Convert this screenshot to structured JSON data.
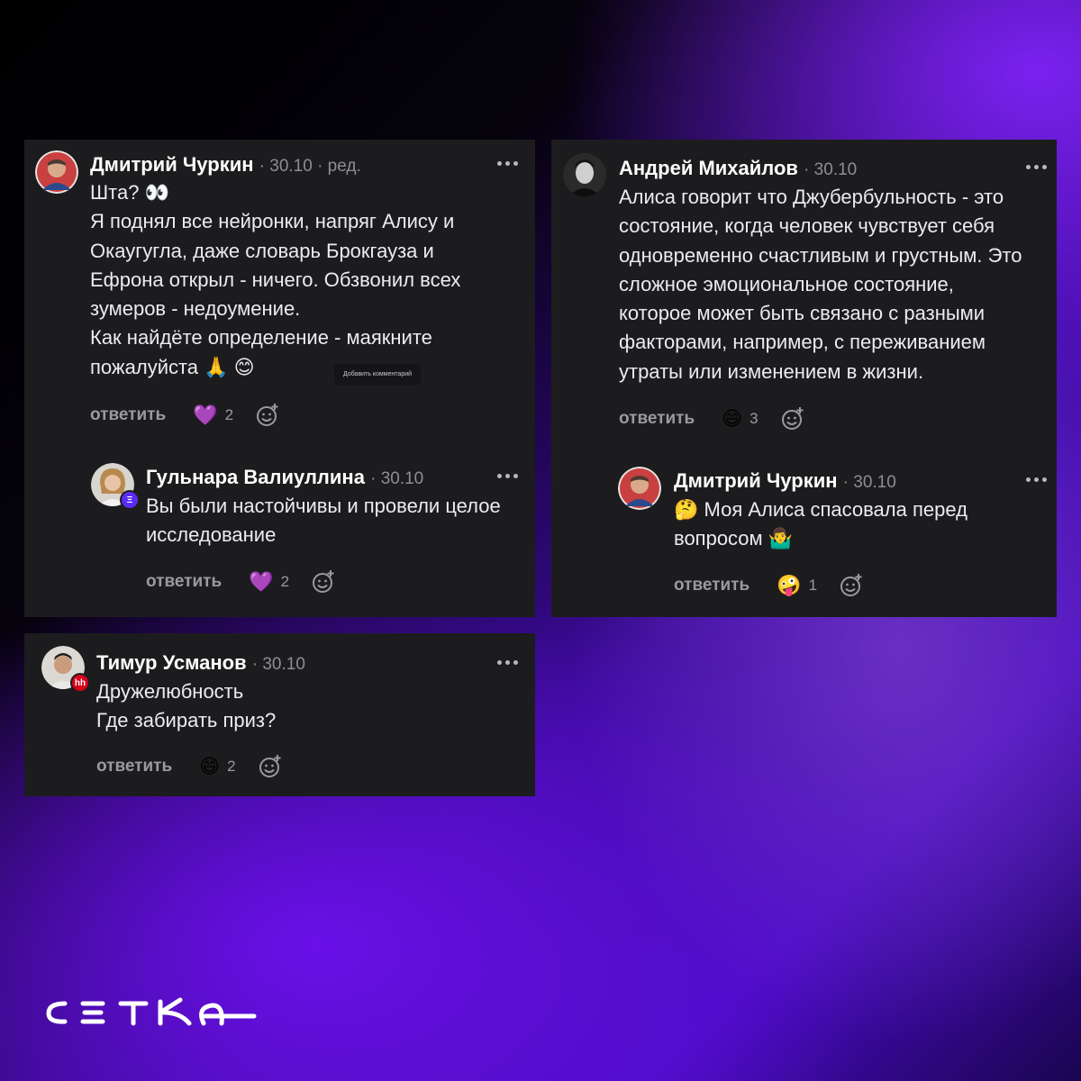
{
  "comments": [
    {
      "author": "Дмитрий Чуркин",
      "date": "· 30.10 · ред.",
      "lines": [
        "Шта? 👀",
        "Я поднял все нейронки, напряг Алису и",
        "Окаугугла, даже словарь Брокгауза и",
        "Ефрона открыл - ничего. Обзвонил всех",
        "зумеров - недоумение.",
        "Как найдёте определение - маякните",
        "пожалуйста 🙏 😊"
      ],
      "reply_label": "ответить",
      "reaction_emoji": "💜",
      "reaction_count": "2",
      "tooltip": "Добавить комментарий"
    },
    {
      "author": "Гульнара Валиуллина",
      "date": "· 30.10",
      "lines": [
        "Вы были настойчивы и провели целое",
        "исследование"
      ],
      "reply_label": "ответить",
      "reaction_emoji": "💜",
      "reaction_count": "2"
    },
    {
      "author": "Андрей Михайлов",
      "date": "· 30.10",
      "lines": [
        "Алиса говорит что Джубербульность - это",
        "состояние, когда человек чувствует себя",
        "одновременно счастливым и грустным. Это",
        "сложное эмоциональное состояние,",
        "которое может быть связано с разными",
        "факторами, например, с переживанием",
        "утраты или изменением в жизни."
      ],
      "reply_label": "ответить",
      "reaction_emoji": "😄",
      "reaction_count": "3"
    },
    {
      "author": "Дмитрий Чуркин",
      "date": "· 30.10",
      "lines": [
        "🤔 Моя Алиса спасовала перед",
        "вопросом 🤷‍♂️"
      ],
      "reply_label": "ответить",
      "reaction_emoji": "🤪",
      "reaction_count": "1"
    },
    {
      "author": "Тимур Усманов",
      "date": "· 30.10",
      "badge": "hh",
      "lines": [
        "Дружелюбность",
        "Где забирать приз?"
      ],
      "reply_label": "ответить",
      "reaction_emoji": "😄",
      "reaction_count": "2"
    }
  ],
  "brand": "CETKA",
  "colors": {
    "card_bg": "#1c1c1e",
    "badge_red": "#d6001c",
    "badge_purple": "#5b2cf5"
  },
  "icons": [
    "more-dots-icon",
    "add-reaction-icon",
    "hh-badge-icon",
    "cetka-logo"
  ]
}
